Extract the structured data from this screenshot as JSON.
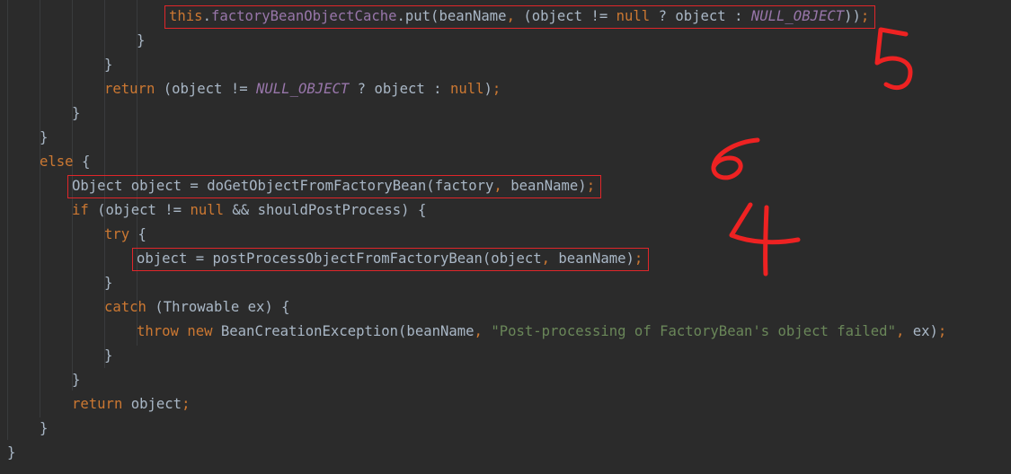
{
  "editor": {
    "lines": [
      {
        "indent": 4,
        "tokens": [
          [
            "kw",
            "this"
          ],
          [
            "pl",
            "."
          ],
          [
            "fld",
            "factoryBeanObjectCache"
          ],
          [
            "pl",
            ".put(beanName"
          ],
          [
            "kw",
            ","
          ],
          [
            "pl",
            " (object != "
          ],
          [
            "kw",
            "null"
          ],
          [
            "pl",
            " ? object : "
          ],
          [
            "ital",
            "NULL_OBJECT"
          ],
          [
            "pl",
            "))"
          ],
          [
            "kw",
            ";"
          ]
        ]
      },
      {
        "indent": 3,
        "tokens": [
          [
            "pl",
            "}"
          ]
        ]
      },
      {
        "indent": 2,
        "tokens": [
          [
            "pl",
            "}"
          ]
        ]
      },
      {
        "indent": 2,
        "tokens": [
          [
            "kw",
            "return"
          ],
          [
            "pl",
            " (object != "
          ],
          [
            "ital",
            "NULL_OBJECT"
          ],
          [
            "pl",
            " ? object : "
          ],
          [
            "kw",
            "null"
          ],
          [
            "pl",
            ")"
          ],
          [
            "kw",
            ";"
          ]
        ]
      },
      {
        "indent": 1,
        "tokens": [
          [
            "pl",
            "}"
          ]
        ]
      },
      {
        "indent": 0,
        "tokens": [
          [
            "pl",
            "}"
          ]
        ]
      },
      {
        "indent": 0,
        "tokens": [
          [
            "kw",
            "else"
          ],
          [
            "pl",
            " {"
          ]
        ]
      },
      {
        "indent": 1,
        "tokens": [
          [
            "pl",
            "Object object = doGetObjectFromFactoryBean(factory"
          ],
          [
            "kw",
            ","
          ],
          [
            "pl",
            " beanName)"
          ],
          [
            "kw",
            ";"
          ]
        ]
      },
      {
        "indent": 1,
        "tokens": [
          [
            "kw",
            "if"
          ],
          [
            "pl",
            " (object != "
          ],
          [
            "kw",
            "null"
          ],
          [
            "pl",
            " && shouldPostProcess) {"
          ]
        ]
      },
      {
        "indent": 2,
        "tokens": [
          [
            "kw",
            "try"
          ],
          [
            "pl",
            " {"
          ]
        ]
      },
      {
        "indent": 3,
        "tokens": [
          [
            "pl",
            "object = postProcessObjectFromFactoryBean(object"
          ],
          [
            "kw",
            ","
          ],
          [
            "pl",
            " beanName)"
          ],
          [
            "kw",
            ";"
          ]
        ]
      },
      {
        "indent": 2,
        "tokens": [
          [
            "pl",
            "}"
          ]
        ]
      },
      {
        "indent": 2,
        "tokens": [
          [
            "kw",
            "catch"
          ],
          [
            "pl",
            " (Throwable ex) {"
          ]
        ]
      },
      {
        "indent": 3,
        "tokens": [
          [
            "kw",
            "throw new"
          ],
          [
            "pl",
            " BeanCreationException(beanName"
          ],
          [
            "kw",
            ","
          ],
          [
            "pl",
            " "
          ],
          [
            "str",
            "\"Post-processing of FactoryBean's object failed\""
          ],
          [
            "kw",
            ","
          ],
          [
            "pl",
            " ex)"
          ],
          [
            "kw",
            ";"
          ]
        ]
      },
      {
        "indent": 2,
        "tokens": [
          [
            "pl",
            "}"
          ]
        ]
      },
      {
        "indent": 1,
        "tokens": [
          [
            "pl",
            "}"
          ]
        ]
      },
      {
        "indent": 1,
        "tokens": [
          [
            "kw",
            "return"
          ],
          [
            "pl",
            " object"
          ],
          [
            "kw",
            ";"
          ]
        ]
      },
      {
        "indent": 0,
        "tokens": [
          [
            "pl",
            "}"
          ]
        ]
      },
      {
        "indent": -1,
        "tokens": [
          [
            "pl",
            "}"
          ]
        ]
      }
    ],
    "highlighted_lines": [
      0,
      7,
      10
    ]
  },
  "annotations": {
    "numbers": [
      "5",
      "6",
      "4"
    ],
    "color": "#ee2222"
  },
  "colors": {
    "background": "#2b2b2b",
    "plain": "#a9b7c6",
    "keyword": "#cc7832",
    "field": "#9876aa",
    "string": "#6a8759",
    "guide": "#393b3d",
    "highlight_box": "#e0262a"
  }
}
